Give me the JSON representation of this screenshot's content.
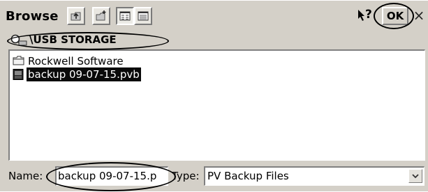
{
  "titlebar": {
    "title": "Browse",
    "up_icon": "folder-up-icon",
    "new_folder_icon": "new-folder-icon",
    "list_view_icon": "list-view-icon",
    "details_view_icon": "details-view-icon",
    "help_label": "?",
    "ok_label": "OK",
    "close_label": "×"
  },
  "pathbar": {
    "icon": "search-drive-icon",
    "path": "\\USB STORAGE"
  },
  "filelist": {
    "items": [
      {
        "label": "Rockwell Software",
        "icon": "folder-icon",
        "selected": false
      },
      {
        "label": "backup 09-07-15.pvb",
        "icon": "file-icon",
        "selected": true
      }
    ]
  },
  "bottombar": {
    "name_label": "Name:",
    "name_value": "backup 09-07-15.p",
    "type_label": "Type:",
    "type_value": "PV Backup Files"
  },
  "colors": {
    "dialog_bg": "#d4d0c8",
    "selection_bg": "#0a0a0a",
    "selection_text": "#ffffff"
  }
}
